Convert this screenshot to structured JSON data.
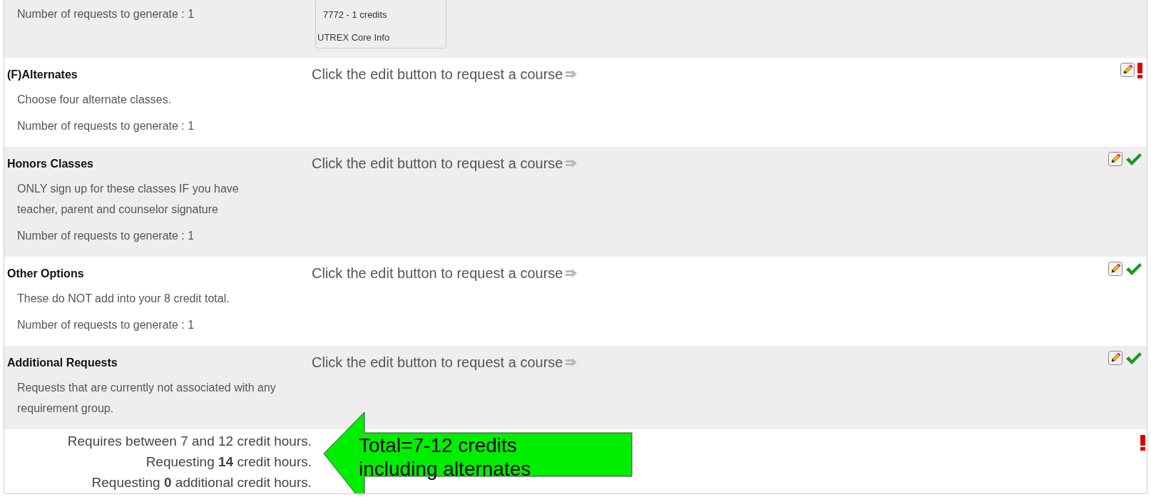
{
  "top_group": {
    "requests": "Number of requests to generate : 1",
    "course_card": [
      "7772 - 1 credits",
      "UTREX Core Info"
    ]
  },
  "groups": [
    {
      "title": "(F)Alternates",
      "description": [
        "Choose four alternate classes."
      ],
      "requests": "Number of requests to generate : 1",
      "prompt": "Click the edit button to request a course",
      "complete": false
    },
    {
      "title": "Honors Classes",
      "description": [
        "ONLY sign up for these classes IF you have",
        "teacher, parent and counselor signature"
      ],
      "requests": "Number of requests to generate : 1",
      "prompt": "Click the edit button to request a course",
      "complete": true
    },
    {
      "title": "Other Options",
      "description": [
        "These do NOT add into your 8 credit total."
      ],
      "requests": "Number of requests to generate : 1",
      "prompt": "Click the edit button to request a course",
      "complete": true
    },
    {
      "title": "Additional Requests",
      "description": [
        "Requests that are currently not associated with any",
        "requirement group."
      ],
      "prompt": "Click the edit button to request a course",
      "complete": true
    }
  ],
  "summary": {
    "lines": [
      "Requires between 7 and 12 credit hours.",
      "Requesting **14** credit hours.",
      "Requesting **0** additional credit hours."
    ],
    "complete": false
  },
  "callout": {
    "lines": [
      "Total=7-12 credits",
      "including alternates"
    ]
  }
}
